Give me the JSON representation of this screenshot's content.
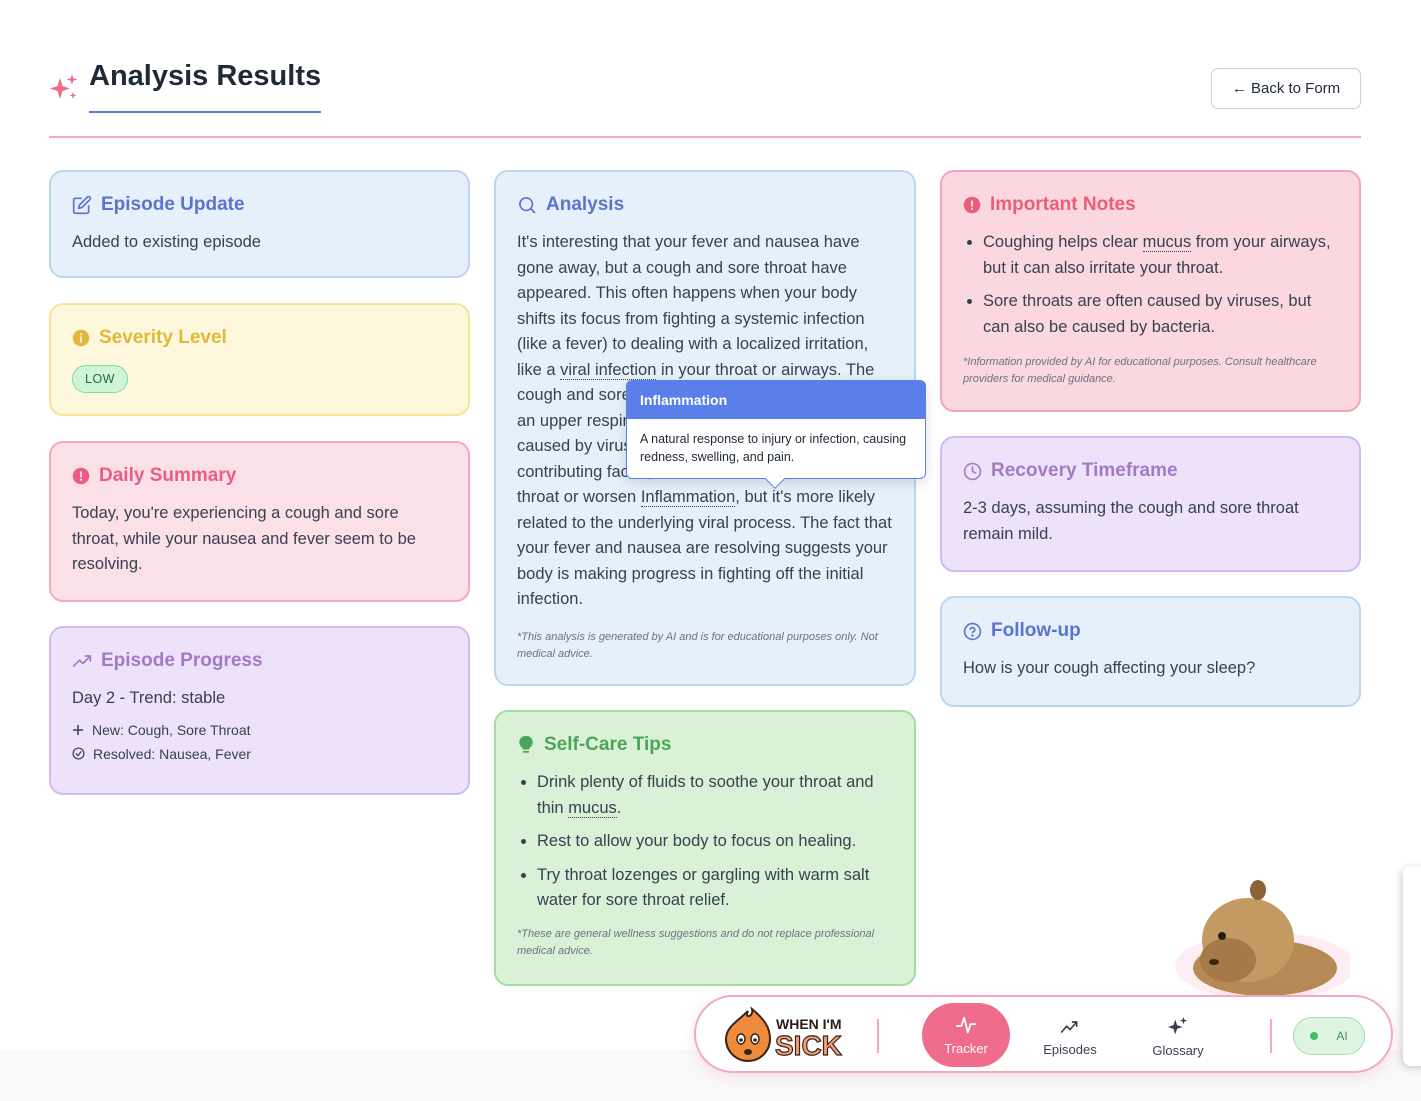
{
  "header": {
    "title": "Analysis Results",
    "back_label": "← Back to Form"
  },
  "episode_update": {
    "title": "Episode Update",
    "text": "Added to existing episode"
  },
  "severity": {
    "title": "Severity Level",
    "level": "LOW"
  },
  "daily_summary": {
    "title": "Daily Summary",
    "text": "Today, you're experiencing a cough and sore throat, while your nausea and fever seem to be resolving."
  },
  "episode_progress": {
    "title": "Episode Progress",
    "day_trend": "Day 2 - Trend: stable",
    "new": "New: Cough, Sore Throat",
    "resolved": "Resolved: Nausea, Fever"
  },
  "analysis": {
    "title": "Analysis",
    "text_before_term1": "It's interesting that your fever and nausea have gone away, but a cough and sore throat have appeared. This often happens when your body shifts its focus from fighting a systemic infection (like a fever) to dealing with a localized irritation, like a ",
    "term1": "viral infection",
    "text_after_term1": " in your throat or airways. The cough and sore throat are common symptoms of an upper respiratory infection, which are often caused by viruses. While acid reflux can also be a contributing factor, as stomach contents irritate the throat or worsen ",
    "term2": "Inflammation",
    "text_after_term2": ", but it's more likely related to the underlying viral process. The fact that your fever and nausea are resolving suggests your body is making progress in fighting off the initial infection.",
    "disclaimer": "*This analysis is generated by AI and is for educational purposes only. Not medical advice."
  },
  "tooltip": {
    "title": "Inflammation",
    "text": "A natural response to injury or infection, causing redness, swelling, and pain."
  },
  "self_care": {
    "title": "Self-Care Tips",
    "tip1_before": "Drink plenty of fluids to soothe your throat and thin ",
    "tip1_term": "mucus",
    "tip1_after": ".",
    "tip2": "Rest to allow your body to focus on healing.",
    "tip3": "Try throat lozenges or gargling with warm salt water for sore throat relief.",
    "disclaimer": "*These are general wellness suggestions and do not replace professional medical advice."
  },
  "important_notes": {
    "title": "Important Notes",
    "note1_before": "Coughing helps clear ",
    "note1_term": "mucus",
    "note1_after": " from your airways, but it can also irritate your throat.",
    "note2": "Sore throats are often caused by viruses, but can also be caused by bacteria.",
    "disclaimer": "*Information provided by AI for educational purposes. Consult healthcare providers for medical guidance."
  },
  "recovery": {
    "title": "Recovery Timeframe",
    "text": "2-3 days, assuming the cough and sore throat remain mild."
  },
  "followup": {
    "title": "Follow-up",
    "text": "How is your cough affecting your sleep?"
  },
  "nav": {
    "logo_line1": "WHEN I'M",
    "logo_line2": "SICK",
    "tracker": "Tracker",
    "episodes": "Episodes",
    "glossary": "Glossary",
    "ai": "AI"
  },
  "colors": {
    "accent_pink": "#ef6c8c",
    "accent_blue": "#5b7fe8",
    "severity_low": "#cff5d8"
  }
}
